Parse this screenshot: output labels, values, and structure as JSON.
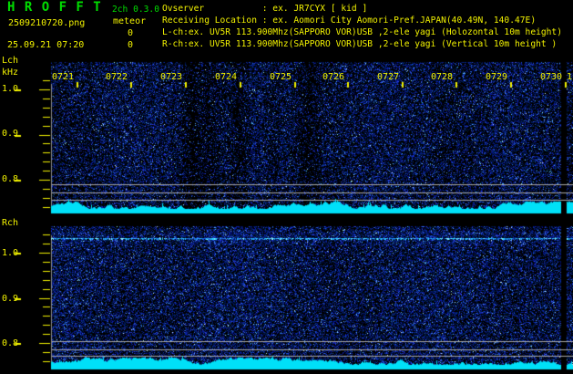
{
  "app": {
    "title": "H R O F F T",
    "version": "2ch 0.3.0",
    "mode": "meteor",
    "filename": "2509210720.png",
    "datetime": "25.09.21 07:20",
    "meteor_count_l": "0",
    "meteor_count_r": "0"
  },
  "info": {
    "observer": "Ovserver           : ex. JR7CYX [ kid ]",
    "location": "Receiving Location : ex. Aomori City Aomori-Pref.JAPAN(40.49N, 140.47E)",
    "lch_line": "L-ch:ex. UV5R 113.900Mhz(SAPPORO VOR)USB ,2-ele yagi (Holozontal 10m height)",
    "rch_line": "R-ch:ex. UV5R 113.900Mhz(SAPPORO VOR)USB ,2-ele yagi (Vertical 10m height )"
  },
  "lch_panel": {
    "label": "Lch",
    "unit": "kHz",
    "time_labels": [
      "0721",
      "0722",
      "0723",
      "0724",
      "0725",
      "0726",
      "0727",
      "0728",
      "0729",
      "0730"
    ],
    "time_label_partial": "1",
    "freq_labels": [
      "1.0",
      "0.9",
      "0.8"
    ]
  },
  "rch_panel": {
    "label": "Rch",
    "freq_labels": [
      "1.0",
      "0.9",
      "0.8"
    ]
  },
  "colors": {
    "background": "#000000",
    "title_green": "#00dd00",
    "text_yellow": "#f2f200",
    "grid_gray": "#a8a8a8",
    "axis_gray": "#8a8a8a",
    "noise_blue": "#2233cc",
    "carrier_cyan": "#33e0ff",
    "floor_cyan": "#00e0f8"
  }
}
